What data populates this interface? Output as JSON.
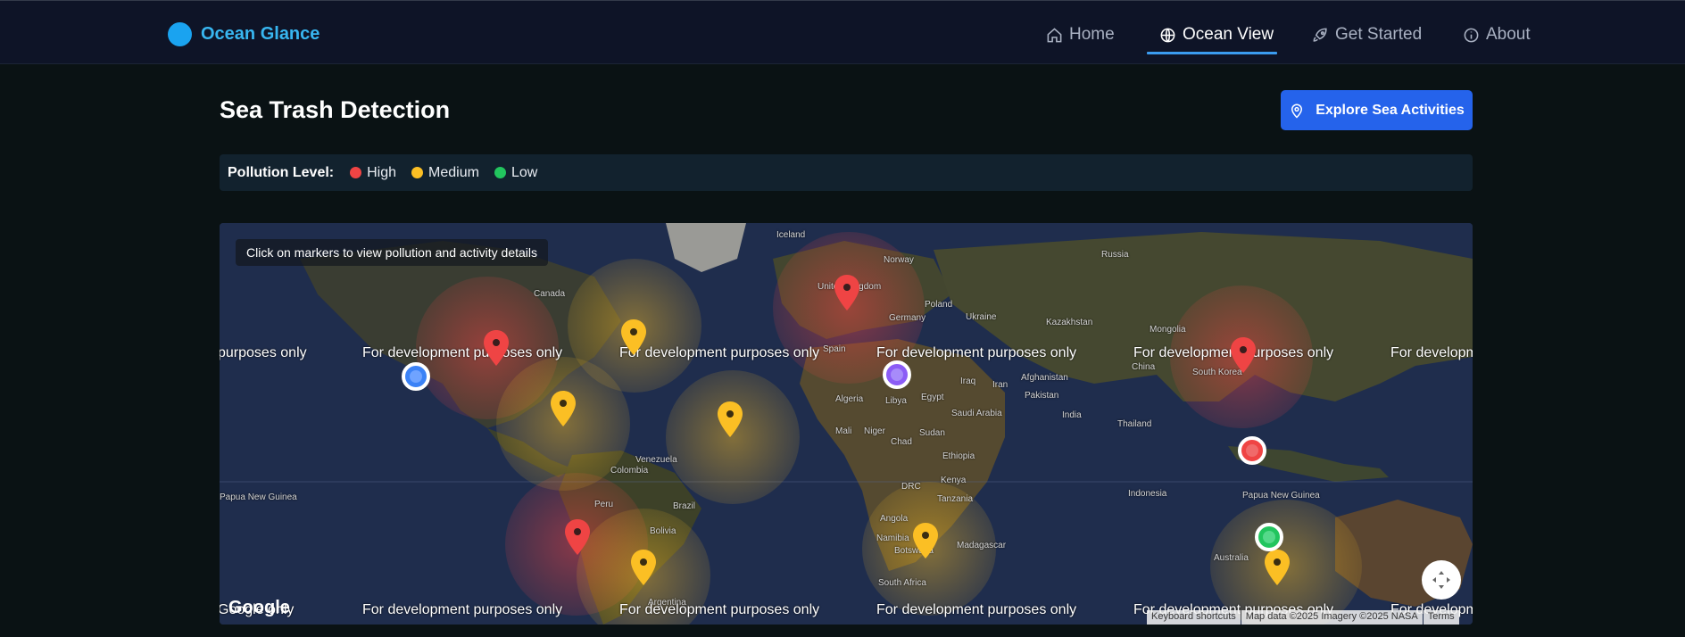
{
  "nav": {
    "brand": "Ocean Glance",
    "items": [
      {
        "label": "Home",
        "icon": "home-icon",
        "active": false
      },
      {
        "label": "Ocean View",
        "icon": "globe-icon",
        "active": true
      },
      {
        "label": "Get Started",
        "icon": "rocket-icon",
        "active": false
      },
      {
        "label": "About",
        "icon": "info-icon",
        "active": false
      }
    ]
  },
  "page": {
    "title": "Sea Trash Detection",
    "explore_button": "Explore Sea Activities"
  },
  "legend": {
    "title": "Pollution Level:",
    "items": [
      {
        "label": "High",
        "color": "#ef4444"
      },
      {
        "label": "Medium",
        "color": "#fbbf24"
      },
      {
        "label": "Low",
        "color": "#22c55e"
      }
    ]
  },
  "map": {
    "hint": "Click on markers to view pollution and activity details",
    "watermark": "For development purposes only",
    "watermark_edge_left": "purposes only",
    "watermark_edge_right": "For developm",
    "watermark_bottom_left": "Google only",
    "google_logo": "Google",
    "attribution": {
      "shortcuts": "Keyboard shortcuts",
      "data": "Map data ©2025 Imagery ©2025 NASA",
      "terms": "Terms"
    },
    "labels": {
      "iceland": "Iceland",
      "canada": "Canada",
      "russia": "Russia",
      "norway": "Norway",
      "uk": "United Kingdom",
      "germany": "Germany",
      "poland": "Poland",
      "ukraine": "Ukraine",
      "kazakhstan": "Kazakhstan",
      "mongolia": "Mongolia",
      "china": "China",
      "spain": "Spain",
      "iraq": "Iraq",
      "iran": "Iran",
      "afghanistan": "Afghanistan",
      "pakistan": "Pakistan",
      "algeria": "Algeria",
      "libya": "Libya",
      "egypt": "Egypt",
      "saudi": "Saudi Arabia",
      "india": "India",
      "thailand": "Thailand",
      "mali": "Mali",
      "niger": "Niger",
      "chad": "Chad",
      "sudan": "Sudan",
      "ethiopia": "Ethiopia",
      "kenya": "Kenya",
      "drc": "DRC",
      "tanzania": "Tanzania",
      "angola": "Angola",
      "namibia": "Namibia",
      "botswana": "Botswana",
      "madagascar": "Madagascar",
      "south_africa": "South Africa",
      "venezuela": "Venezuela",
      "colombia": "Colombia",
      "peru": "Peru",
      "brazil": "Brazil",
      "bolivia": "Bolivia",
      "argentina": "Argentina",
      "png": "Papua New Guinea",
      "png2": "Papua New Guinea",
      "indonesia": "Indonesia",
      "australia": "Australia",
      "korea": "South Korea"
    },
    "colors": {
      "high": "#ef4444",
      "medium": "#fbbf24",
      "low": "#22c55e",
      "activity_blue": "#3b82f6",
      "activity_purple": "#8b5cf6"
    }
  }
}
